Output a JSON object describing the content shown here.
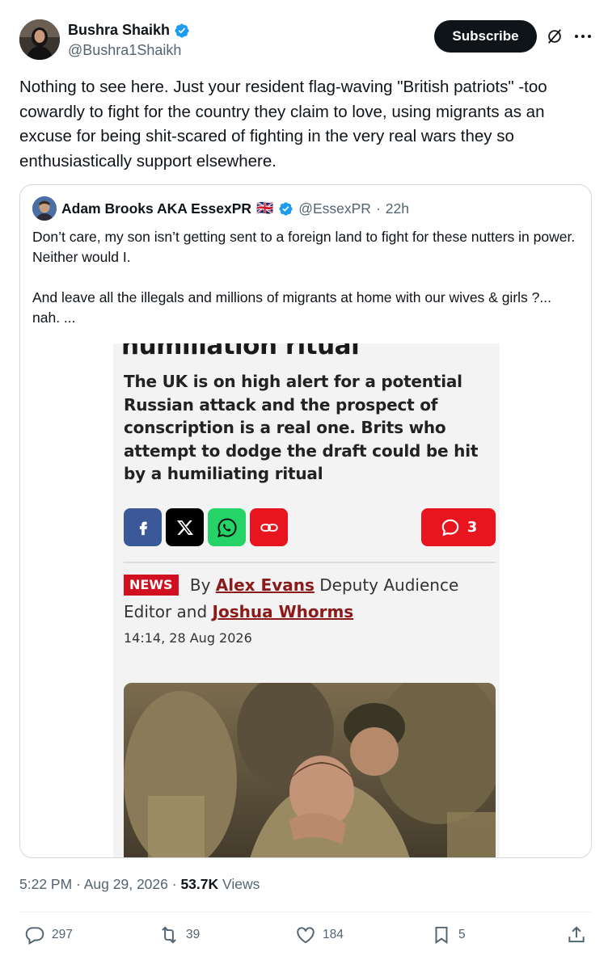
{
  "author": {
    "name": "Bushra Shaikh",
    "handle": "@Bushra1Shaikh"
  },
  "subscribe_label": "Subscribe",
  "tweet_text": "Nothing to see here. Just your resident flag-waving \"British patriots\" -too cowardly to fight for the country they claim to love, using migrants as an excuse for being shit-scared of fighting in the very real wars they so enthusiastically support elsewhere.",
  "quote": {
    "name": "Adam Brooks AKA EssexPR",
    "flag": "🇬🇧",
    "handle": "@EssexPR",
    "separator": "·",
    "time": "22h",
    "text_1": "Don’t care, my son isn’t getting sent to a foreign land to fight for these nutters in power. Neither would I.",
    "text_2": "And leave all the illegals and millions of migrants at home with our wives & girls ?... nah. ...",
    "article": {
      "headline_fragment": "humiliation ritual",
      "subheadline": "The UK is on high alert for a potential Russian attack and the prospect of conscription is a real one. Brits who attempt to dodge the draft could be hit by a humiliating ritual",
      "comment_count": "3",
      "badge": "NEWS",
      "by": "By",
      "author_1": "Alex Evans",
      "role_1": "Deputy Audience Editor and",
      "author_2": "Joshua Whorms",
      "date": "14:14, 28 Aug 2026"
    }
  },
  "meta": {
    "time": "5:22 PM · Aug 29, 2026 ·",
    "views_count": "53.7K",
    "views_label": "Views"
  },
  "actions": {
    "replies": "297",
    "reposts": "39",
    "likes": "184",
    "bookmarks": "5"
  },
  "colors": {
    "text": "#0f1419",
    "muted": "#536471",
    "verified": "#1d9bf0",
    "facebook": "#3b5998",
    "whatsapp": "#25d366",
    "mirror_red": "#e8141e"
  }
}
